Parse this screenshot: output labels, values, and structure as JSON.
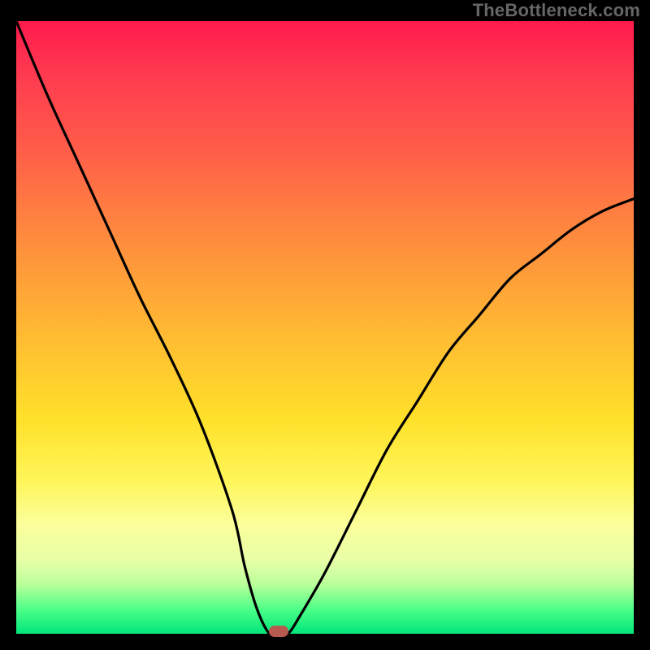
{
  "attribution": "TheBottleneck.com",
  "colors": {
    "frame_bg": "#000000",
    "gradient_top": "#ff1a4d",
    "gradient_bottom": "#00e57a",
    "curve": "#000000",
    "marker": "#b85a52",
    "attribution_text": "#666666"
  },
  "chart_data": {
    "type": "line",
    "title": "",
    "xlabel": "",
    "ylabel": "",
    "xlim": [
      0,
      100
    ],
    "ylim": [
      0,
      100
    ],
    "grid": false,
    "legend": false,
    "series": [
      {
        "name": "bottleneck-curve",
        "x": [
          0,
          5,
          10,
          15,
          20,
          25,
          30,
          35,
          37,
          39,
          41,
          42.5,
          44,
          46,
          50,
          55,
          60,
          65,
          70,
          75,
          80,
          85,
          90,
          95,
          100
        ],
        "y": [
          100,
          88,
          77,
          66,
          55,
          45,
          34,
          20,
          11,
          4,
          0,
          0,
          0,
          3,
          10,
          20,
          30,
          38,
          46,
          52,
          58,
          62,
          66,
          69,
          71
        ]
      }
    ],
    "marker": {
      "x": 42.5,
      "y": 0,
      "meaning": "optimal-point"
    },
    "note": "x and y are in percent of plot area; y=0 is bottom (green), y=100 is top (red). Values estimated from pixels."
  }
}
